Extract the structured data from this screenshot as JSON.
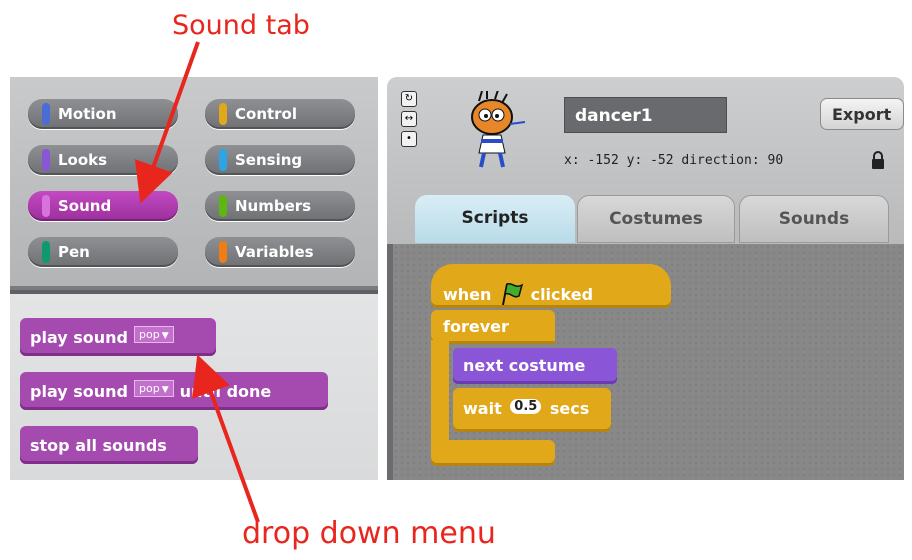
{
  "annotations": {
    "sound_tab": "Sound tab",
    "dropdown_menu": "drop down menu",
    "arrow_color": "#e8261e"
  },
  "palette": {
    "categories": [
      {
        "label": "Motion",
        "color": "#4a6cd4"
      },
      {
        "label": "Control",
        "color": "#e1a91a"
      },
      {
        "label": "Looks",
        "color": "#8a55d7"
      },
      {
        "label": "Sensing",
        "color": "#2ca5e2"
      },
      {
        "label": "Sound",
        "color": "#bb42c3",
        "selected": true
      },
      {
        "label": "Numbers",
        "color": "#5cb712"
      },
      {
        "label": "Pen",
        "color": "#0e9a6c"
      },
      {
        "label": "Variables",
        "color": "#ee7d16"
      }
    ],
    "blocks": [
      {
        "text": "play sound",
        "dropdown": "pop"
      },
      {
        "text": "play sound",
        "dropdown": "pop",
        "suffix": "until done"
      },
      {
        "text": "stop all sounds"
      }
    ]
  },
  "sprite": {
    "name": "dancer1",
    "export_label": "Export",
    "coords": "x: -152  y: -52   direction: 90",
    "rotation_buttons": [
      "rotate-icon",
      "flip-icon",
      "no-rotate-icon"
    ]
  },
  "tabs": [
    {
      "label": "Scripts",
      "active": true
    },
    {
      "label": "Costumes",
      "active": false
    },
    {
      "label": "Sounds",
      "active": false
    }
  ],
  "script": {
    "hat_before": "when",
    "hat_after": "clicked",
    "forever": "forever",
    "next_costume": "next costume",
    "wait_before": "wait",
    "wait_value": "0.5",
    "wait_after": "secs"
  }
}
